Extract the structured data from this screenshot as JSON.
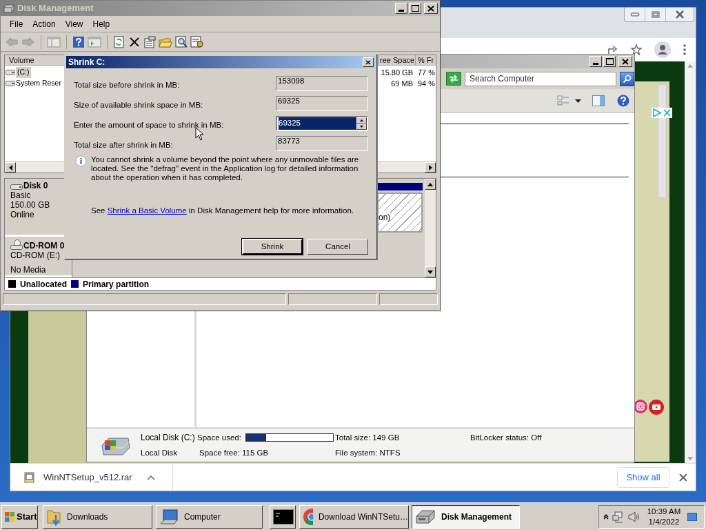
{
  "disk_management": {
    "title": "Disk Management",
    "menu": [
      "File",
      "Action",
      "View",
      "Help"
    ],
    "volume_list": {
      "columns": [
        "Volume",
        "ree Space",
        "% Fr"
      ],
      "rows": [
        {
          "volume": "(C:)",
          "free_space": "15.80 GB",
          "percent_free": "77 %",
          "selected": true
        },
        {
          "volume": "System Reser",
          "free_space": "69 MB",
          "percent_free": "94 %",
          "selected": false
        }
      ]
    },
    "disks": [
      {
        "kind": "hdd",
        "name": "Disk 0",
        "details": [
          "Basic",
          "150.00 GB",
          "Online"
        ]
      },
      {
        "kind": "cdrom",
        "name": "CD-ROM 0",
        "details": [
          "CD-ROM (E:)",
          "No Media"
        ]
      }
    ],
    "partition_label": "on)",
    "legend": [
      {
        "label": "Unallocated",
        "color": "#000000"
      },
      {
        "label": "Primary partition",
        "color": "#000080"
      }
    ]
  },
  "shrink_dialog": {
    "title": "Shrink C:",
    "fields": [
      {
        "kind": "readonly",
        "label": "Total size before shrink in MB:",
        "value": "153098"
      },
      {
        "kind": "readonly",
        "label": "Size of available shrink space in MB:",
        "value": "69325"
      },
      {
        "kind": "spin",
        "label": "Enter the amount of space to shrink in MB:",
        "value": "69325",
        "value_selected": true
      },
      {
        "kind": "readonly",
        "label": "Total size after shrink in MB:",
        "value": "83773"
      }
    ],
    "info": "You cannot shrink a volume beyond the point where any unmovable files are located. See the \"defrag\" event in the Application log for detailed information about the operation when it has completed.",
    "help_prefix": "See",
    "help_link": "Shrink a Basic Volume",
    "help_suffix": "in Disk Management help for more information.",
    "buttons": [
      {
        "label": "Shrink",
        "default": true
      },
      {
        "label": "Cancel",
        "default": false
      }
    ]
  },
  "explorer": {
    "search": {
      "placeholder": "Search Computer"
    },
    "details": {
      "name": "Local Disk (C:)",
      "type": "Local Disk",
      "space_used_label": "Space used:",
      "level": 0.23,
      "space_free": "Space free: 115 GB",
      "total_size": "Total size: 149 GB",
      "file_system": "File system: NTFS",
      "bitlocker": "BitLocker status: Off"
    }
  },
  "browser": {
    "download": {
      "file": "WinNTSetup_v512.rar"
    },
    "show_all": "Show all"
  },
  "taskbar": {
    "start": "Start",
    "items": [
      {
        "kind": "folder",
        "label": "Downloads",
        "selected": false
      },
      {
        "kind": "computer",
        "label": "Computer",
        "selected": false
      },
      {
        "kind": "console",
        "selected": false
      },
      {
        "kind": "chrome",
        "label": "Download WinNTSetu…",
        "selected": false
      },
      {
        "kind": "disk",
        "label": "Disk Management",
        "selected": true
      }
    ],
    "clock": {
      "time": "10:39 AM",
      "date": "1/4/2022"
    }
  }
}
